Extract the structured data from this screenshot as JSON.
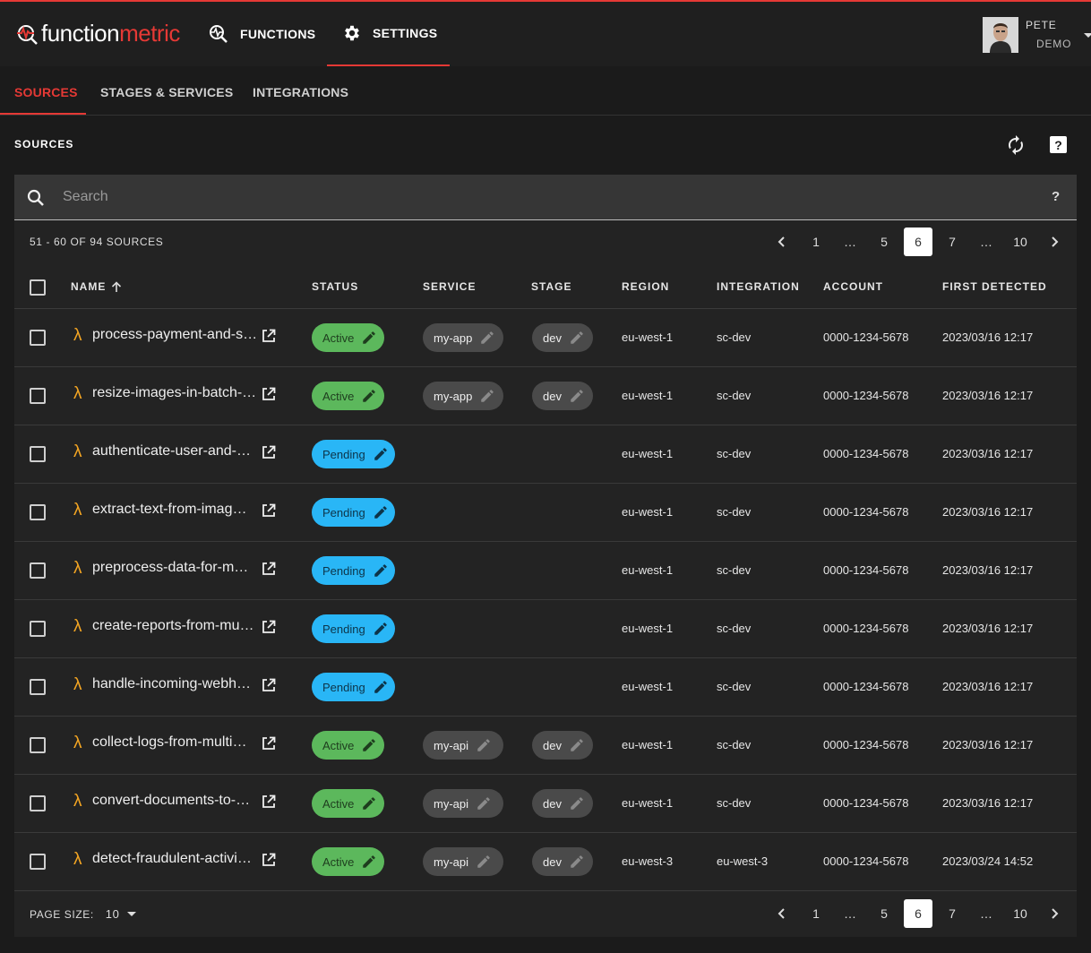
{
  "app": {
    "logo_part1": "function",
    "logo_part2": "metric"
  },
  "nav": {
    "functions": "FUNCTIONS",
    "settings": "SETTINGS"
  },
  "user": {
    "first": "PETE",
    "last": "DEMO"
  },
  "subtabs": [
    "SOURCES",
    "STAGES & SERVICES",
    "INTEGRATIONS"
  ],
  "section_title": "SOURCES",
  "search": {
    "placeholder": "Search",
    "help": "?"
  },
  "count_label": "51 - 60 OF 94 SOURCES",
  "pagination": {
    "pages": [
      "1",
      "…",
      "5",
      "6",
      "7",
      "…",
      "10"
    ],
    "current": "6"
  },
  "columns": {
    "name": "NAME",
    "status": "STATUS",
    "service": "SERVICE",
    "stage": "STAGE",
    "region": "REGION",
    "integration": "INTEGRATION",
    "account": "ACCOUNT",
    "first_detected": "FIRST DETECTED"
  },
  "rows": [
    {
      "name": "process-payment-and-s…",
      "status": "Active",
      "service": "my-app",
      "stage": "dev",
      "region": "eu-west-1",
      "integration": "sc-dev",
      "account": "0000-1234-5678",
      "first_detected": "2023/03/16 12:17"
    },
    {
      "name": "resize-images-in-batch-…",
      "status": "Active",
      "service": "my-app",
      "stage": "dev",
      "region": "eu-west-1",
      "integration": "sc-dev",
      "account": "0000-1234-5678",
      "first_detected": "2023/03/16 12:17"
    },
    {
      "name": "authenticate-user-and-…",
      "status": "Pending",
      "service": "",
      "stage": "",
      "region": "eu-west-1",
      "integration": "sc-dev",
      "account": "0000-1234-5678",
      "first_detected": "2023/03/16 12:17"
    },
    {
      "name": "extract-text-from-imag…",
      "status": "Pending",
      "service": "",
      "stage": "",
      "region": "eu-west-1",
      "integration": "sc-dev",
      "account": "0000-1234-5678",
      "first_detected": "2023/03/16 12:17"
    },
    {
      "name": "preprocess-data-for-m…",
      "status": "Pending",
      "service": "",
      "stage": "",
      "region": "eu-west-1",
      "integration": "sc-dev",
      "account": "0000-1234-5678",
      "first_detected": "2023/03/16 12:17"
    },
    {
      "name": "create-reports-from-mu…",
      "status": "Pending",
      "service": "",
      "stage": "",
      "region": "eu-west-1",
      "integration": "sc-dev",
      "account": "0000-1234-5678",
      "first_detected": "2023/03/16 12:17"
    },
    {
      "name": "handle-incoming-webh…",
      "status": "Pending",
      "service": "",
      "stage": "",
      "region": "eu-west-1",
      "integration": "sc-dev",
      "account": "0000-1234-5678",
      "first_detected": "2023/03/16 12:17"
    },
    {
      "name": "collect-logs-from-multi…",
      "status": "Active",
      "service": "my-api",
      "stage": "dev",
      "region": "eu-west-1",
      "integration": "sc-dev",
      "account": "0000-1234-5678",
      "first_detected": "2023/03/16 12:17"
    },
    {
      "name": "convert-documents-to-…",
      "status": "Active",
      "service": "my-api",
      "stage": "dev",
      "region": "eu-west-1",
      "integration": "sc-dev",
      "account": "0000-1234-5678",
      "first_detected": "2023/03/16 12:17"
    },
    {
      "name": "detect-fraudulent-activi…",
      "status": "Active",
      "service": "my-api",
      "stage": "dev",
      "region": "eu-west-3",
      "integration": "eu-west-3",
      "account": "0000-1234-5678",
      "first_detected": "2023/03/24 14:52"
    }
  ],
  "page_size": {
    "label": "PAGE SIZE:",
    "value": "10"
  },
  "colors": {
    "accent": "#e53935",
    "active": "#5cb85c",
    "pending": "#29b6f6",
    "lambda": "#f5a623"
  },
  "icons": {
    "functions": "pulse-magnifier-icon",
    "settings": "gear-icon",
    "refresh": "refresh-icon",
    "help": "help-box-icon",
    "search": "search-icon",
    "lambda": "lambda-icon",
    "external": "open-in-new-icon",
    "edit": "pencil-icon"
  }
}
